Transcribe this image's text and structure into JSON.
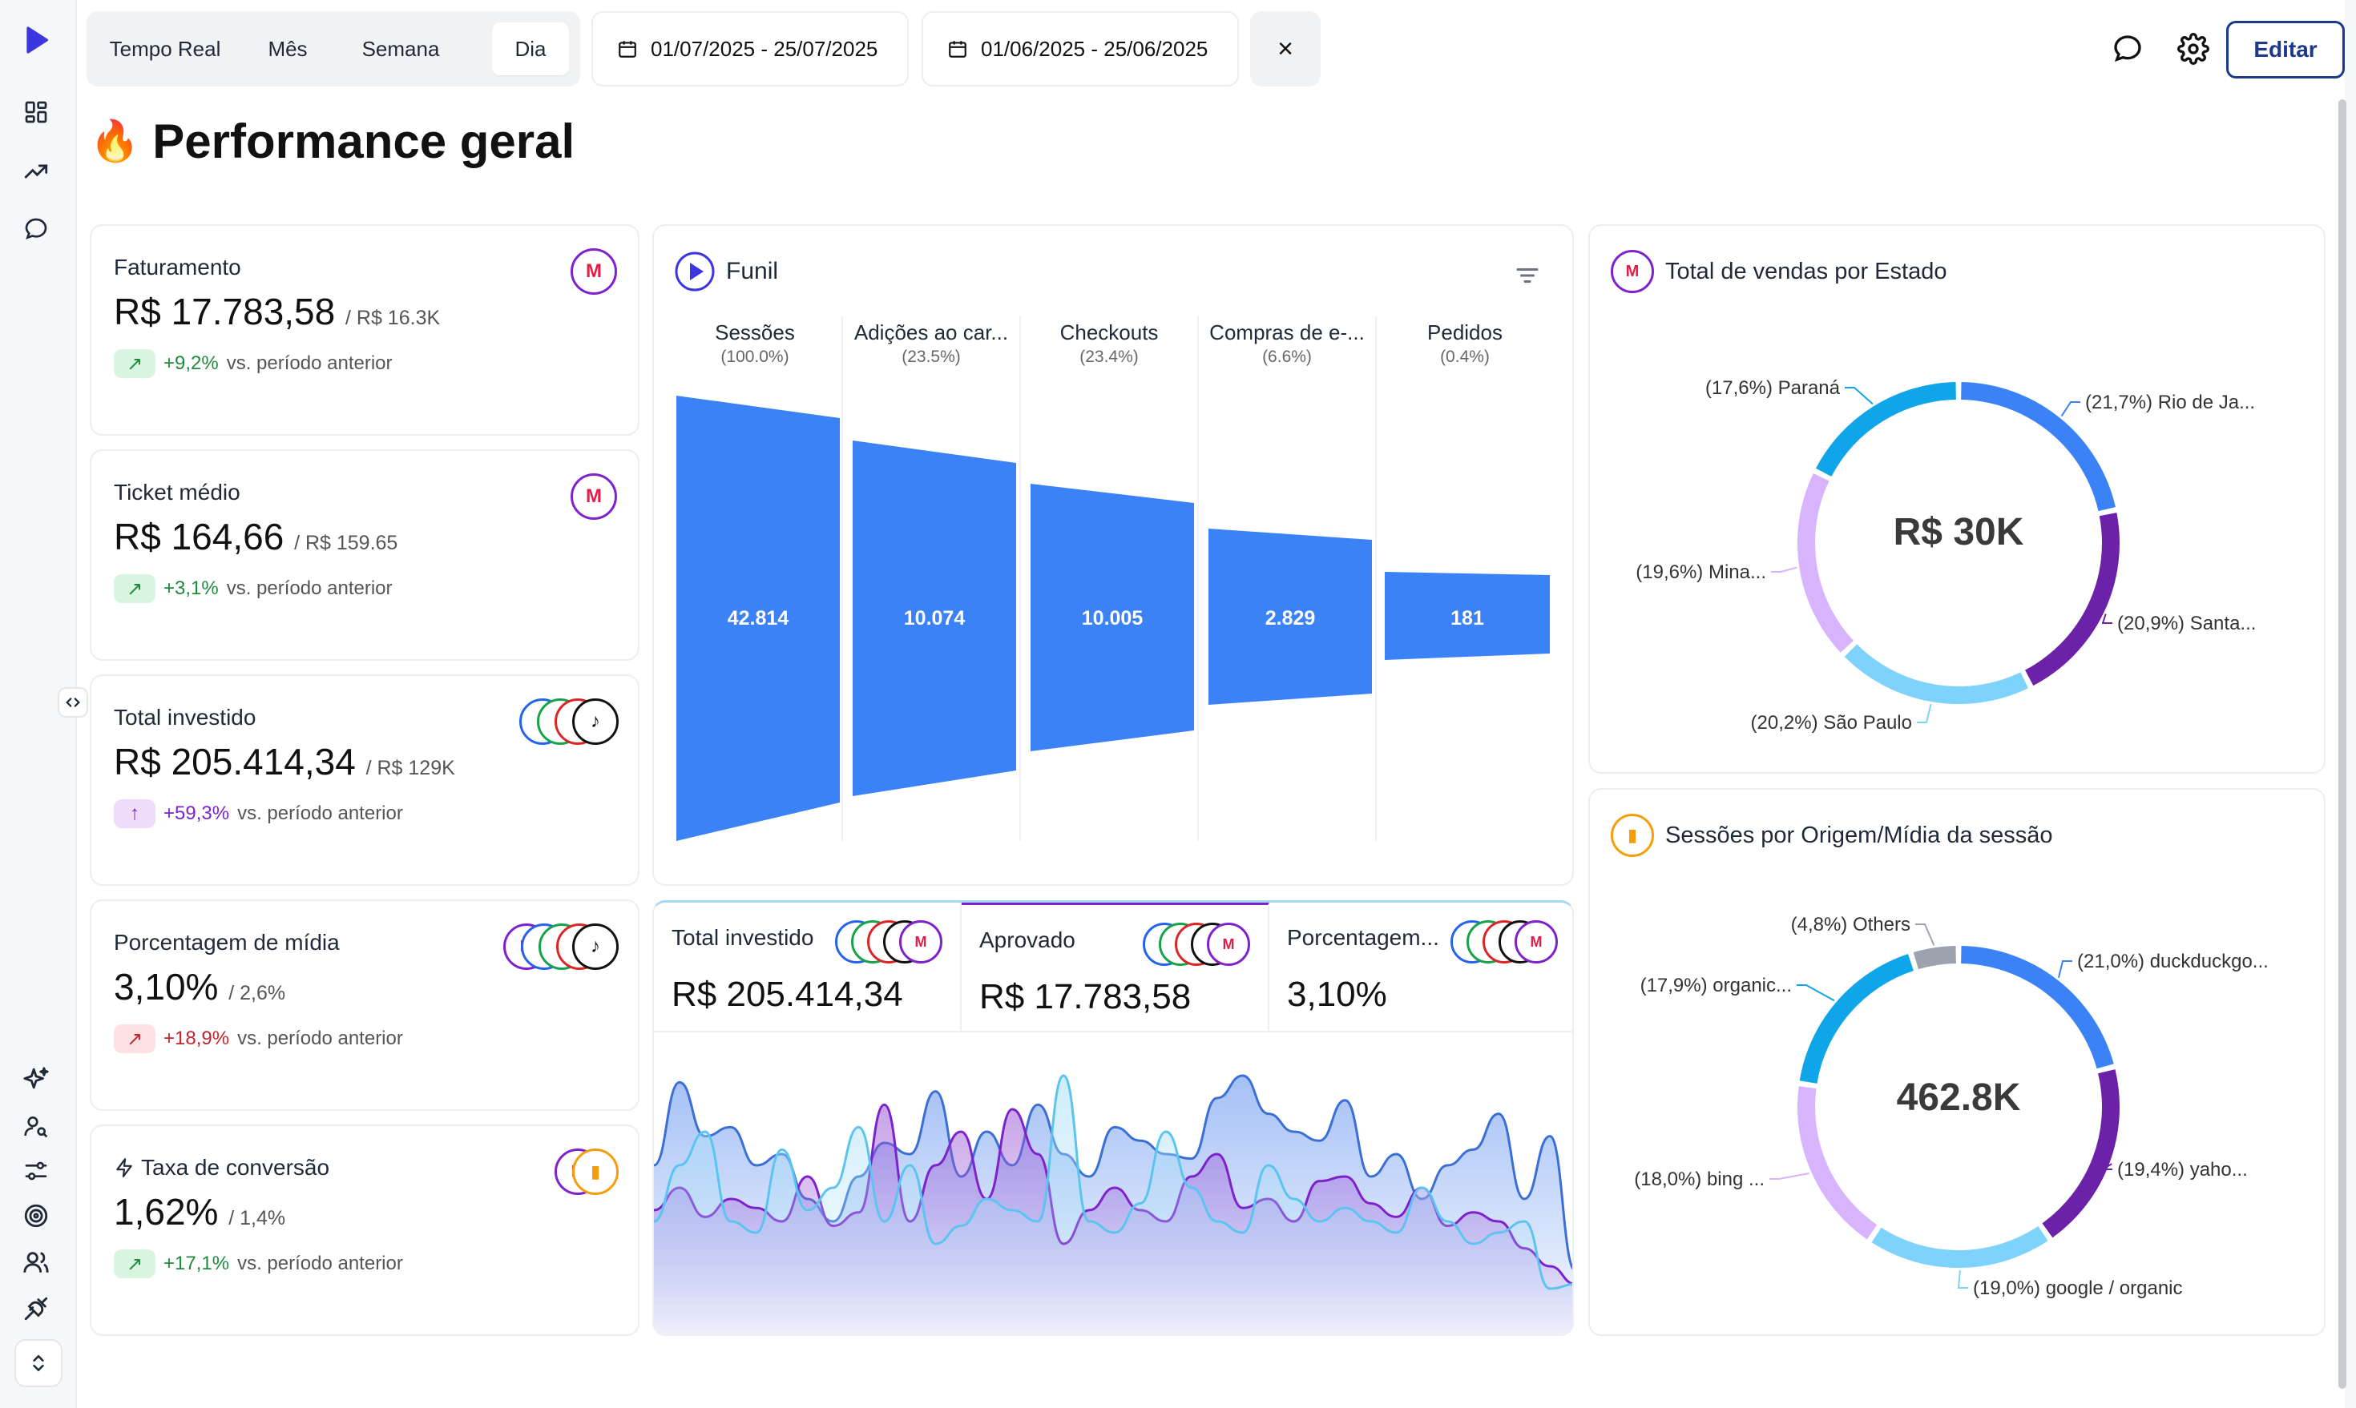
{
  "sidebar": {
    "icons": [
      "logo-play-icon",
      "dashboard-icon",
      "trend-icon",
      "chat-icon",
      "sparkle-icon",
      "user-search-icon",
      "sliders-icon",
      "target-icon",
      "users-icon",
      "plug-icon"
    ],
    "collapse_icon": "code-chevrons-icon",
    "expand_icon": "chevrons-updown-icon"
  },
  "toolbar": {
    "tabs": [
      {
        "label": "Tempo Real",
        "active": false
      },
      {
        "label": "Mês",
        "active": false
      },
      {
        "label": "Semana",
        "active": false
      },
      {
        "label": "Dia",
        "active": true
      }
    ],
    "date_range_current": "01/07/2025 - 25/07/2025",
    "date_range_compare": "01/06/2025 - 25/06/2025",
    "close_label": "×",
    "edit_label": "Editar"
  },
  "page": {
    "emoji": "🔥",
    "title": "Performance geral"
  },
  "kpis": [
    {
      "title": "Faturamento",
      "value": "R$ 17.783,58",
      "prev": "/ R$ 16.3K",
      "delta": "+9,2%",
      "delta_text": "vs. período anterior",
      "trend": "green",
      "arrow": "↗"
    },
    {
      "title": "Ticket médio",
      "value": "R$ 164,66",
      "prev": "/ R$ 159.65",
      "delta": "+3,1%",
      "delta_text": "vs. período anterior",
      "trend": "green",
      "arrow": "↗"
    },
    {
      "title": "Total investido",
      "value": "R$ 205.414,34",
      "prev": "/ R$ 129K",
      "delta": "+59,3%",
      "delta_text": "vs. período anterior",
      "trend": "purple",
      "arrow": "↑"
    },
    {
      "title": "Porcentagem de mídia",
      "value": "3,10%",
      "prev": "/ 2,6%",
      "delta": "+18,9%",
      "delta_text": "vs. período anterior",
      "trend": "red",
      "arrow": "↗"
    },
    {
      "title": "Taxa de conversão",
      "value": "1,62%",
      "prev": "/ 1,4%",
      "delta": "+17,1%",
      "delta_text": "vs. período anterior",
      "trend": "green",
      "arrow": "↗"
    }
  ],
  "funnel": {
    "title": "Funil",
    "stages": [
      {
        "label": "Sessões",
        "pct": "(100.0%)",
        "value": "42.814"
      },
      {
        "label": "Adições ao car...",
        "pct": "(23.5%)",
        "value": "10.074"
      },
      {
        "label": "Checkouts",
        "pct": "(23.4%)",
        "value": "10.005"
      },
      {
        "label": "Compras de e-...",
        "pct": "(6.6%)",
        "value": "2.829"
      },
      {
        "label": "Pedidos",
        "pct": "(0.4%)",
        "value": "181"
      }
    ]
  },
  "metrics_strip": [
    {
      "title": "Total investido",
      "value": "R$ 205.414,34"
    },
    {
      "title": "Aprovado",
      "value": "R$ 17.783,58"
    },
    {
      "title": "Porcentagem...",
      "value": "3,10%"
    }
  ],
  "sales_by_state": {
    "title": "Total de vendas por Estado",
    "center": "R$ 30K",
    "slices": [
      {
        "label": "(21,7%) Rio de Ja...",
        "pct": 21.7,
        "color": "#3b82f6"
      },
      {
        "label": "(20,9%) Santa...",
        "pct": 20.9,
        "color": "#6b21a8"
      },
      {
        "label": "(20,2%) São Paulo",
        "pct": 20.2,
        "color": "#7dd3fc"
      },
      {
        "label": "(19,6%) Mina...",
        "pct": 19.6,
        "color": "#d8b4fe"
      },
      {
        "label": "(17,6%) Paraná",
        "pct": 17.6,
        "color": "#0ea5e9"
      }
    ]
  },
  "sessions_by_source": {
    "title": "Sessões por Origem/Mídia da sessão",
    "center": "462.8K",
    "slices": [
      {
        "label": "(21,0%) duckduckgo...",
        "pct": 21.0,
        "color": "#3b82f6"
      },
      {
        "label": "(19,4%) yaho...",
        "pct": 19.4,
        "color": "#6b21a8"
      },
      {
        "label": "(19,0%) google / organic",
        "pct": 19.0,
        "color": "#7dd3fc"
      },
      {
        "label": "(18,0%) bing ...",
        "pct": 18.0,
        "color": "#d8b4fe"
      },
      {
        "label": "(17,9%) organic...",
        "pct": 17.9,
        "color": "#0ea5e9"
      },
      {
        "label": "(4,8%) Others",
        "pct": 4.8,
        "color": "#9ca3af"
      }
    ]
  },
  "line_chart": {
    "series": [
      {
        "color": "#3b6fd6",
        "fill": "#5b8def",
        "values": [
          0.55,
          0.92,
          0.68,
          0.72,
          0.55,
          0.6,
          0.4,
          0.3,
          0.5,
          0.65,
          0.6,
          0.88,
          0.5,
          0.7,
          0.55,
          0.82,
          0.6,
          0.5,
          0.72,
          0.66,
          0.6,
          0.58,
          0.85,
          0.95,
          0.78,
          0.7,
          0.66,
          0.84,
          0.5,
          0.6,
          0.4,
          0.55,
          0.62,
          0.78,
          0.4,
          0.68,
          0.08
        ]
      },
      {
        "color": "#7e22ce",
        "fill": "#9b59d6",
        "values": [
          0.35,
          0.45,
          0.32,
          0.4,
          0.36,
          0.3,
          0.5,
          0.28,
          0.34,
          0.82,
          0.3,
          0.55,
          0.7,
          0.4,
          0.8,
          0.6,
          0.2,
          0.35,
          0.45,
          0.35,
          0.3,
          0.5,
          0.6,
          0.36,
          0.4,
          0.3,
          0.48,
          0.5,
          0.38,
          0.32,
          0.45,
          0.28,
          0.34,
          0.3,
          0.18,
          0.1,
          0.02
        ]
      },
      {
        "color": "#5bc4f0",
        "fill": "#a8def8",
        "values": [
          0.3,
          0.55,
          0.7,
          0.3,
          0.25,
          0.62,
          0.35,
          0.45,
          0.72,
          0.3,
          0.55,
          0.2,
          0.28,
          0.4,
          0.35,
          0.3,
          0.95,
          0.3,
          0.25,
          0.38,
          0.7,
          0.45,
          0.3,
          0.25,
          0.55,
          0.4,
          0.3,
          0.36,
          0.3,
          0.25,
          0.45,
          0.3,
          0.2,
          0.25,
          0.3,
          0.0,
          0.02
        ]
      }
    ]
  }
}
